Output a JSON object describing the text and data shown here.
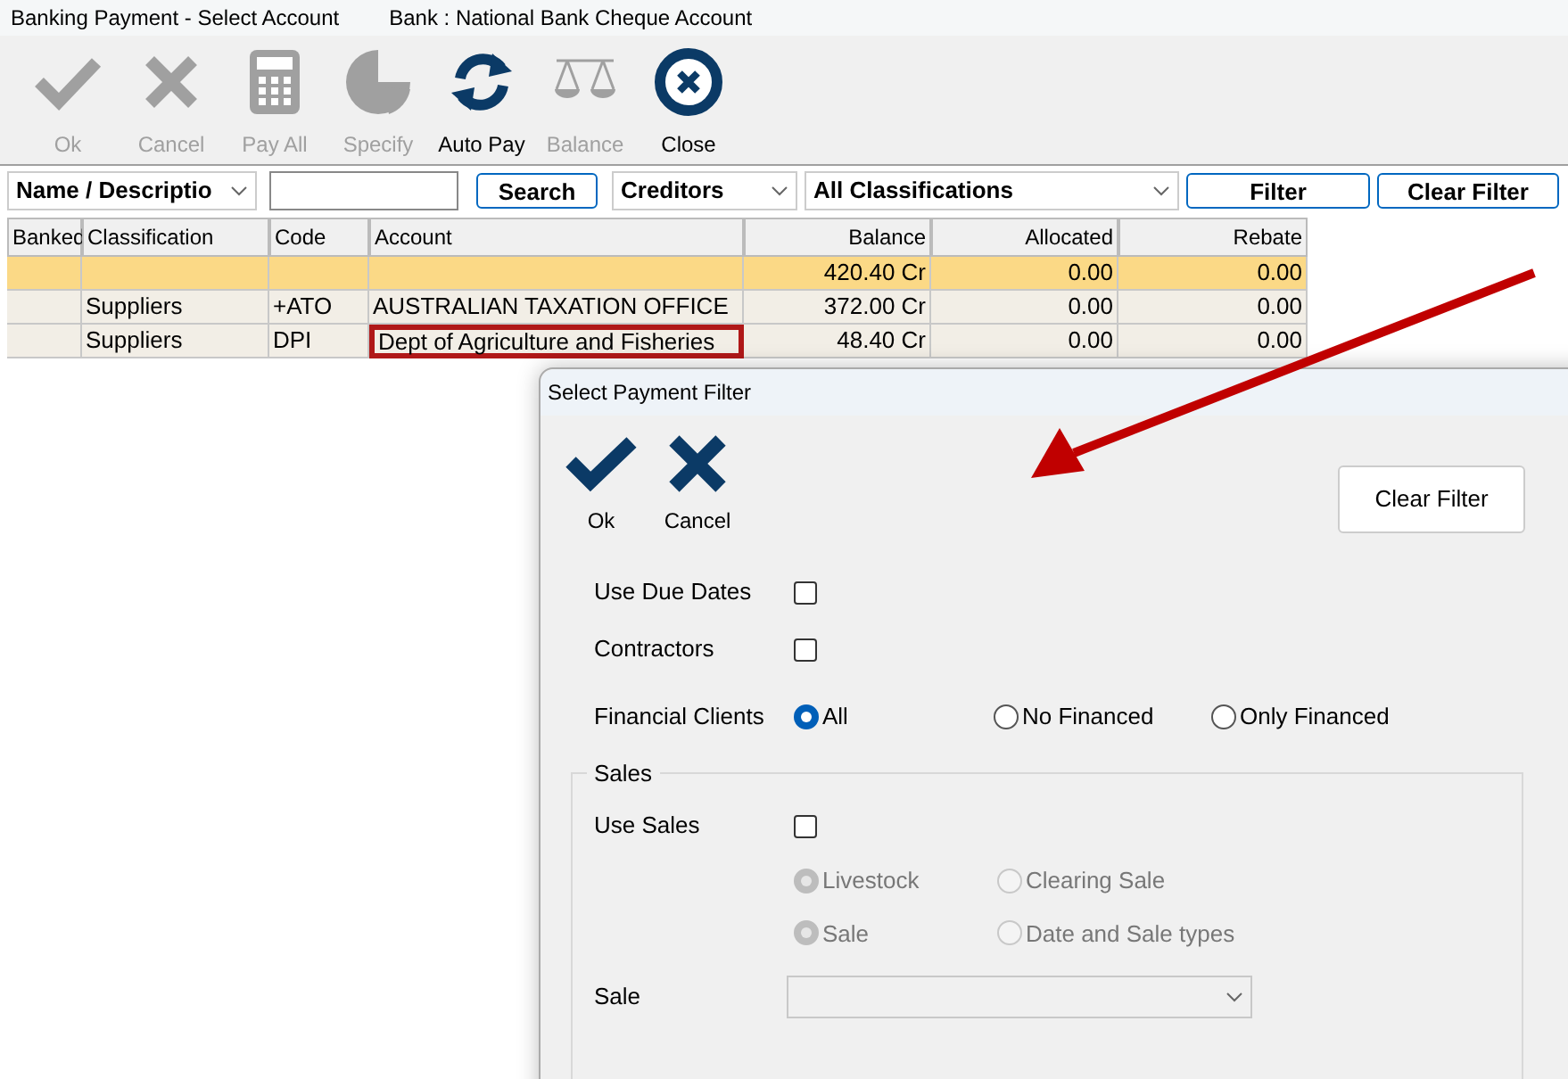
{
  "window": {
    "title": "Banking Payment - Select Account",
    "bank": "Bank : National Bank Cheque Account"
  },
  "toolbar": [
    {
      "kind": "check",
      "label": "Ok",
      "disabled": true
    },
    {
      "kind": "cross",
      "label": "Cancel",
      "disabled": true
    },
    {
      "kind": "calculator",
      "label": "Pay All",
      "disabled": true
    },
    {
      "kind": "pie",
      "label": "Specify",
      "disabled": true
    },
    {
      "kind": "refresh",
      "label": "Auto Pay",
      "disabled": false
    },
    {
      "kind": "scale",
      "label": "Balance",
      "disabled": true
    },
    {
      "kind": "close",
      "label": "Close",
      "disabled": false
    }
  ],
  "filter_bar": {
    "search_by": "Name / Descriptio",
    "search_button": "Search",
    "type": "Creditors",
    "classification": "All Classifications",
    "filter_button": "Filter",
    "clear_filter_button": "Clear Filter"
  },
  "table": {
    "columns": [
      "Banked",
      "Classification",
      "Code",
      "Account",
      "Balance",
      "Allocated",
      "Rebate"
    ],
    "rows": [
      {
        "selected": true,
        "marked": false,
        "cells": [
          "",
          "",
          "",
          "",
          "420.40 Cr",
          "0.00",
          "0.00"
        ]
      },
      {
        "selected": false,
        "marked": false,
        "cells": [
          "",
          "Suppliers",
          "+ATO",
          "AUSTRALIAN TAXATION OFFICE",
          "372.00 Cr",
          "0.00",
          "0.00"
        ]
      },
      {
        "selected": false,
        "marked": true,
        "cells": [
          "",
          "Suppliers",
          "DPI",
          "Dept of Agriculture and Fisheries",
          "48.40 Cr",
          "0.00",
          "0.00"
        ]
      }
    ]
  },
  "dialog": {
    "title": "Select Payment Filter",
    "ok": "Ok",
    "cancel": "Cancel",
    "clear_filter": "Clear Filter",
    "use_due_dates": {
      "label": "Use Due Dates",
      "checked": false
    },
    "contractors": {
      "label": "Contractors",
      "checked": false
    },
    "financial_clients": {
      "label": "Financial Clients",
      "options": [
        {
          "label": "All",
          "selected": true
        },
        {
          "label": "No Financed",
          "selected": false
        },
        {
          "label": "Only Financed",
          "selected": false
        }
      ]
    },
    "sales": {
      "title": "Sales",
      "use_sales": {
        "label": "Use Sales",
        "checked": false
      },
      "options": [
        {
          "label": "Livestock",
          "selected": true,
          "disabled": true
        },
        {
          "label": "Clearing Sale",
          "selected": false,
          "disabled": true
        },
        {
          "label": "Sale",
          "selected": true,
          "disabled": true
        },
        {
          "label": "Date and Sale types",
          "selected": false,
          "disabled": true
        }
      ],
      "sale": {
        "label": "Sale",
        "disabled": true
      }
    }
  }
}
